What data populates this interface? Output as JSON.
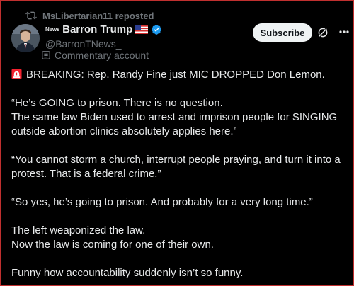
{
  "repost": {
    "text": "MsLibertarian11 reposted",
    "icon": "repost-icon"
  },
  "author": {
    "news_tag": "News",
    "name": "Barron Trump",
    "flag": "us-flag",
    "verified": "verified-badge",
    "handle": "@BarronTNews_",
    "commentary_label": "Commentary account",
    "avatar": "avatar"
  },
  "actions": {
    "subscribe_label": "Subscribe",
    "grok_icon": "grok-icon",
    "more_icon": "more-icon"
  },
  "post": {
    "siren_icon": "siren-icon",
    "paragraphs": [
      "BREAKING: Rep. Randy Fine just MIC DROPPED Don Lemon.",
      "“He’s GOING to prison. There is no question.",
      "The same law Biden used to arrest and imprison people for SINGING outside abortion clinics absolutely applies here.”",
      "“You cannot storm a church, interrupt people praying, and turn it into a protest. That is a federal crime.”",
      "“So yes, he’s going to prison. And probably for a very long time.”",
      "The left weaponized the law.",
      "Now the law is coming for one of their own.",
      "Funny how accountability suddenly isn’t so funny."
    ]
  },
  "colors": {
    "background": "#000000",
    "text": "#e7e9ea",
    "muted": "#71767b",
    "verified": "#1d9bf0",
    "siren": "#f4212e",
    "frame": "#c0302f"
  }
}
